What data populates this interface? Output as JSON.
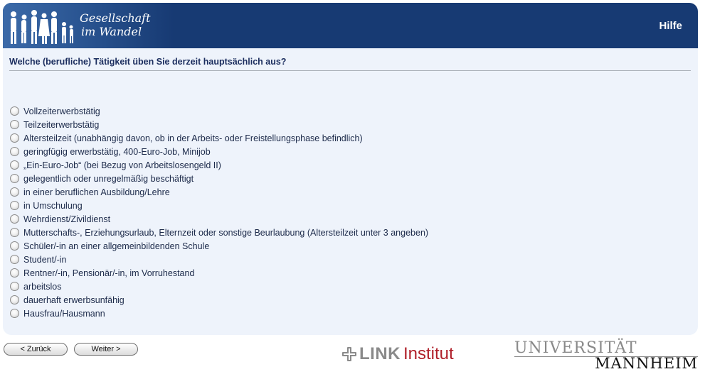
{
  "header": {
    "logo_line1": "Gesellschaft",
    "logo_line2": "im Wandel",
    "help_label": "Hilfe"
  },
  "question": {
    "text": "Welche (berufliche) Tätigkeit üben Sie derzeit hauptsächlich aus?",
    "options": [
      "Vollzeiterwerbstätig",
      "Teilzeiterwerbstätig",
      "Altersteilzeit (unabhängig davon, ob in der Arbeits- oder Freistellungsphase befindlich)",
      "geringfügig erwerbstätig, 400-Euro-Job, Minijob",
      "„Ein-Euro-Job“ (bei Bezug von Arbeitslosengeld II)",
      "gelegentlich oder unregelmäßig beschäftigt",
      "in einer beruflichen Ausbildung/Lehre",
      "in Umschulung",
      "Wehrdienst/Zivildienst",
      "Mutterschafts-, Erziehungsurlaub, Elternzeit oder sonstige Beurlaubung (Altersteilzeit unter 3 angeben)",
      "Schüler/-in an einer allgemeinbildenden Schule",
      "Student/-in",
      "Rentner/-in, Pensionär/-in, im Vorruhestand",
      "arbeitslos",
      "dauerhaft erwerbsunfähig",
      "Hausfrau/Hausmann"
    ]
  },
  "navigation": {
    "back_label": "< Zurück",
    "next_label": "Weiter >"
  },
  "footer": {
    "link_logo_bold": "LINK",
    "link_logo_rest": "Institut",
    "uni_line1": "UNIVERSITÄT",
    "uni_line2": "MANNHEIM"
  },
  "colors": {
    "header_bg": "#173a73",
    "panel_bg": "#eef3fb",
    "question_text": "#1b2d5e",
    "link_red": "#b0202a"
  },
  "icons": [
    "people-silhouettes-icon",
    "radio-button-icon",
    "link-cross-icon"
  ]
}
